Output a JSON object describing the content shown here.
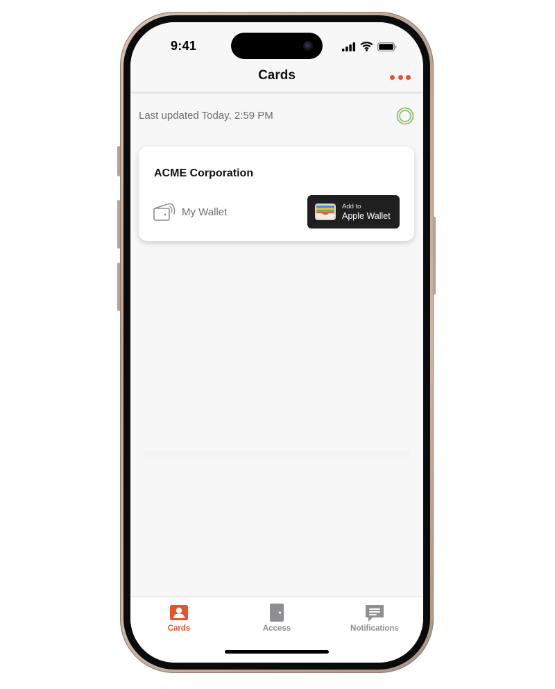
{
  "status_bar": {
    "time": "9:41"
  },
  "header": {
    "title": "Cards",
    "more_icon": "ellipsis-horizontal-icon"
  },
  "content": {
    "last_updated": "Last updated Today, 2:59 PM",
    "refresh_icon": "refresh-ring-icon",
    "card": {
      "title": "ACME Corporation",
      "wallet_label": "My Wallet",
      "wallet_icon": "contactless-wallet-icon",
      "apple_wallet": {
        "line1": "Add to",
        "line2": "Apple Wallet",
        "icon": "apple-wallet-icon"
      }
    }
  },
  "tab_bar": {
    "tabs": [
      {
        "label": "Cards",
        "icon": "id-card-icon",
        "active": true
      },
      {
        "label": "Access",
        "icon": "door-icon",
        "active": false
      },
      {
        "label": "Notifications",
        "icon": "message-icon",
        "active": false
      }
    ]
  },
  "colors": {
    "accent": "#e8522b",
    "refresh_ring": "#7ab648",
    "inactive": "#8e8e93",
    "background": "#f7f7f7",
    "apple_wallet_button": "#1f1f1f"
  }
}
